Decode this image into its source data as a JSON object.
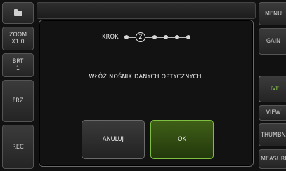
{
  "left_sidebar": {
    "zoom_label": "ZOOM",
    "zoom_value": "X1.0",
    "brt_label": "BRT",
    "brt_value": "1",
    "frz_label": "FRZ",
    "rec_label": "REC"
  },
  "right_sidebar": {
    "items": [
      {
        "label": "MENU"
      },
      {
        "label": "GAIN"
      },
      {
        "label": "LIVE",
        "active": true
      },
      {
        "label": "VIEW"
      },
      {
        "label": "THUMBNAIL"
      },
      {
        "label": "MEASURE"
      }
    ]
  },
  "dialog": {
    "step_label": "KROK",
    "current_step": "2",
    "total_steps": 6,
    "message": "WŁÓŻ NOŚNIK DANYCH OPTYCZNYCH.",
    "cancel_label": "ANULUJ",
    "ok_label": "OK"
  },
  "colors": {
    "accent_green": "#8fd14f",
    "ok_button": "#2f4a12"
  }
}
